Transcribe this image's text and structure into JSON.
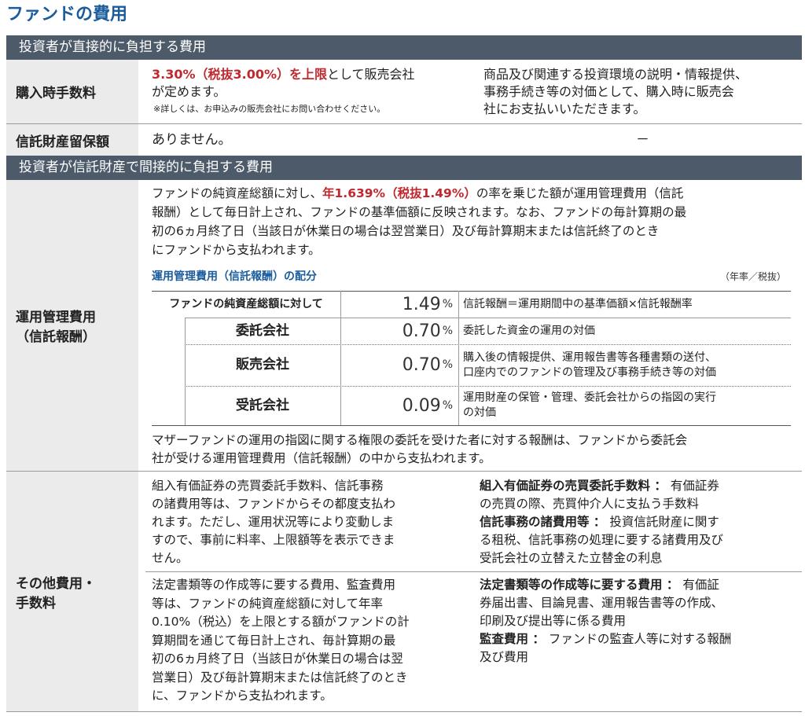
{
  "page_title": "ファンドの費用",
  "section_direct": "投資者が直接的に負担する費用",
  "section_indirect": "投資者が信託財産で間接的に負担する費用",
  "purchase": {
    "label": "購入時手数料",
    "rate": "3.30%（税抜3.00%）を上限",
    "text_after": "として販売会社",
    "text_line2": "が定めます。",
    "note": "※詳しくは、お申込みの販売会社にお問い合わせください。",
    "desc": [
      "商品及び関連する投資環境の説明・情報提供、",
      "事務手続き等の対価として、購入時に販売会",
      "社にお支払いいただきます。"
    ]
  },
  "retention": {
    "label": "信託財産留保額",
    "value": "ありません。",
    "desc": "－"
  },
  "mgmt": {
    "label_line1": "運用管理費用",
    "label_line2": "（信託報酬）",
    "p1_pre": "ファンドの純資産総額に対し、",
    "p1_rate": "年1.639%（税抜1.49%）",
    "p1_post": "の率を乗じた額が運用管理費用（信託",
    "p_lines": [
      "報酬）として毎日計上され、ファンドの基準価額に反映されます。なお、ファンドの毎計算期の最",
      "初の6ヵ月終了日（当該日が休業日の場合は翌営業日）及び毎計算期末または信託終了のとき",
      "にファンドから支払われます。"
    ],
    "alloc_title": "運用管理費用（信託報酬）の配分",
    "alloc_unit": "（年率／税抜）",
    "alloc_rows": [
      {
        "label": "ファンドの純資産総額に対して",
        "value": "1.49",
        "pct": "%",
        "desc": [
          "信託報酬＝運用期間中の基準価額×信託報酬率"
        ]
      },
      {
        "label": "委託会社",
        "value": "0.70",
        "pct": "%",
        "desc": [
          "委託した資金の運用の対価"
        ]
      },
      {
        "label": "販売会社",
        "value": "0.70",
        "pct": "%",
        "desc": [
          "購入後の情報提供、運用報告書等各種書類の送付、",
          "口座内でのファンドの管理及び事務手続き等の対価"
        ]
      },
      {
        "label": "受託会社",
        "value": "0.09",
        "pct": "%",
        "desc": [
          "運用財産の保管・管理、委託会社からの指図の実行",
          "の対価"
        ]
      }
    ],
    "footer": [
      "マザーファンドの運用の指図に関する権限の委託を受けた者に対する報酬は、ファンドから委託会",
      "社が受ける運用管理費用（信託報酬）の中から支払われます。"
    ]
  },
  "other": {
    "label_line1": "その他費用・",
    "label_line2": "手数料",
    "a_left": [
      "組入有価証券の売買委託手数料、信託事務",
      "の諸費用等は、ファンドからその都度支払わ",
      "れます。ただし、運用状況等により変動しま",
      "すので、事前に料率、上限額等を表示できま",
      "せん。"
    ],
    "a_right_b1": "組入有価証券の売買委託手数料 ：",
    "a_right_t1a": " 有価証券",
    "a_right_t1b": "の売買の際、売買仲介人に支払う手数料",
    "a_right_b2": "信託事務の諸費用等 ：",
    "a_right_t2a": " 投資信託財産に関す",
    "a_right_t2b": [
      "る租税、信託事務の処理に要する諸費用及び",
      "受託会社の立替えた立替金の利息"
    ],
    "b_left": [
      "法定書類等の作成等に要する費用、監査費用",
      "等は、ファンドの純資産総額に対して年率",
      "0.10%（税込）を上限とする額がファンドの計",
      "算期間を通じて毎日計上され、毎計算期の最",
      "初の6ヵ月終了日（当該日が休業日の場合は翌",
      "営業日）及び毎計算期末または信託終了のとき",
      "に、ファンドから支払われます。"
    ],
    "b_right_b1": "法定書類等の作成等に要する費用 ：",
    "b_right_t1a": " 有価証",
    "b_right_t1b": [
      "券届出書、目論見書、運用報告書等の作成、",
      "印刷及び提出等に係る費用"
    ],
    "b_right_b2": "監査費用 ：",
    "b_right_t2a": " ファンドの監査人等に対する報酬",
    "b_right_t2b": "及び費用"
  }
}
